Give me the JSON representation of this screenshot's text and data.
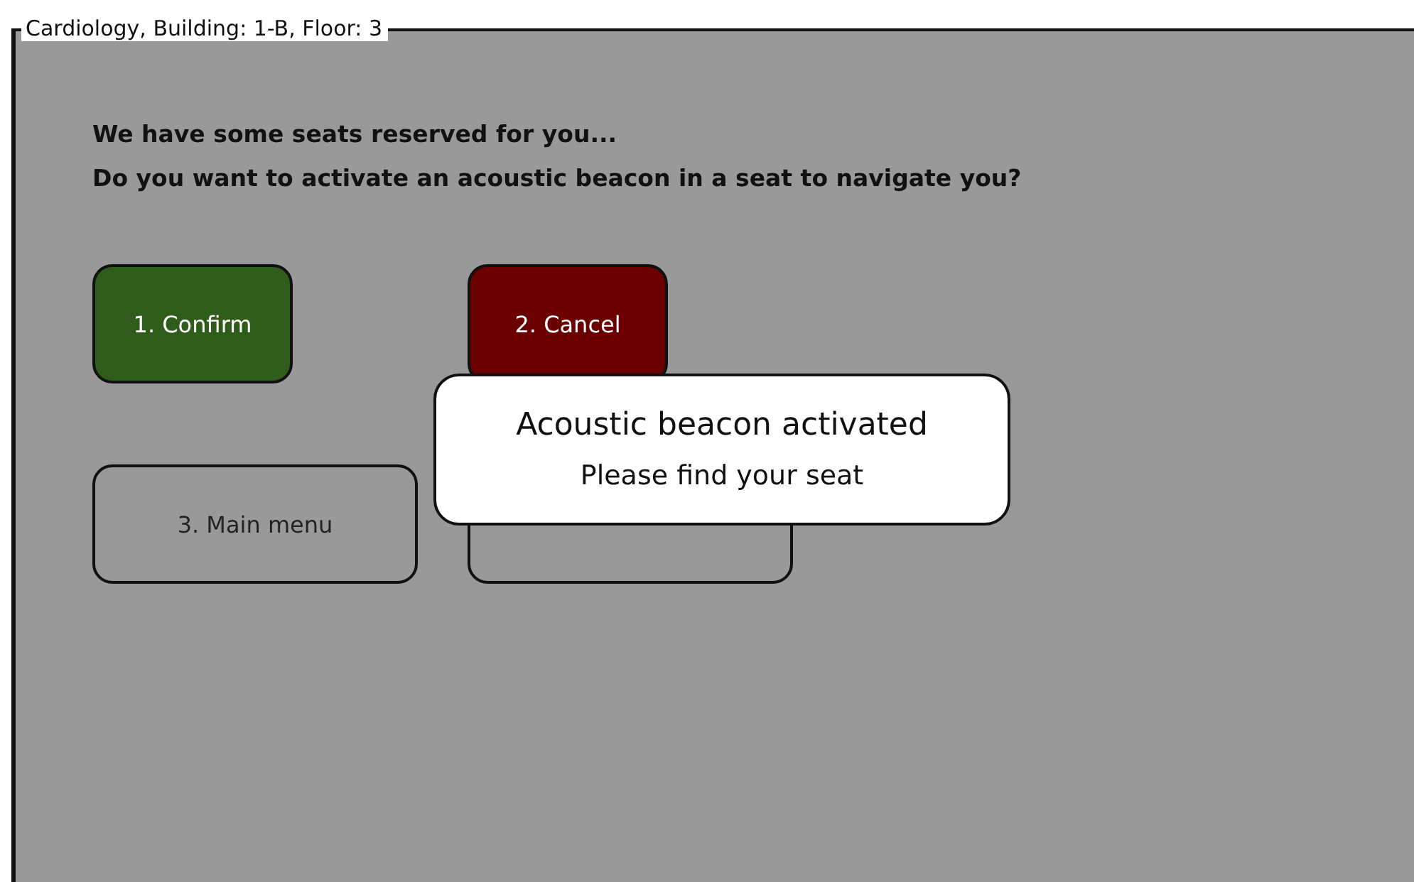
{
  "panel": {
    "title": "Cardiology, Building: 1-B, Floor: 3"
  },
  "prompt": [
    "We have some seats reserved for you...",
    "Do you want to activate an acoustic beacon in a seat to navigate you?"
  ],
  "buttons": [
    {
      "kind": "filled",
      "label": "1. Confirm",
      "color": "#2f5b1b"
    },
    {
      "kind": "filled",
      "label": "2. Cancel",
      "color": "#6a0000"
    },
    {
      "kind": "outline",
      "label": "3. Main menu"
    },
    {
      "kind": "outline"
    }
  ],
  "toast": {
    "title": "Acoustic beacon activated",
    "message": "Please find your seat"
  }
}
